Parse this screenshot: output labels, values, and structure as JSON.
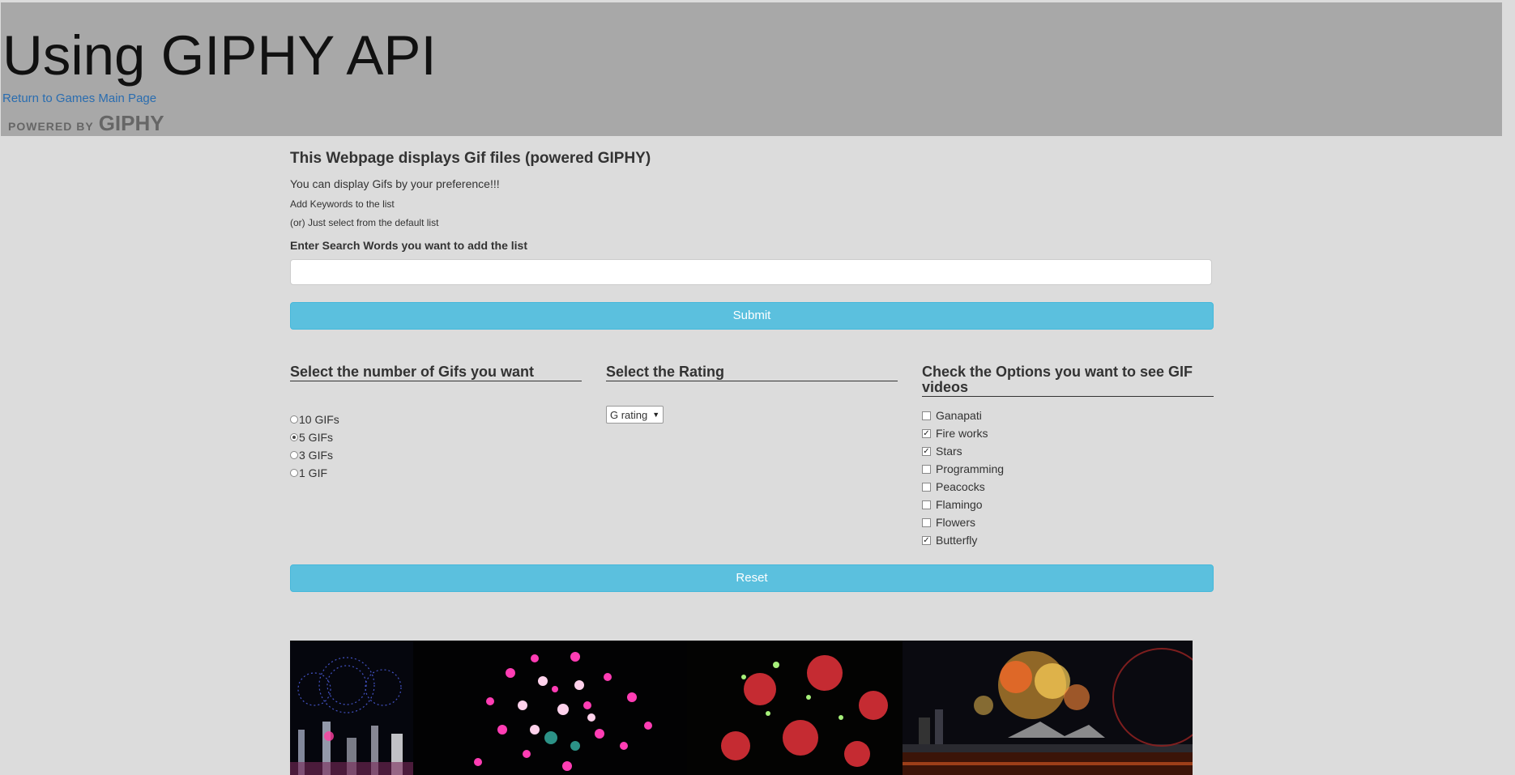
{
  "header": {
    "title": "Using GIPHY API",
    "return_link": "Return to Games Main Page",
    "powered_small": "POWERED BY",
    "powered_brand": "GIPHY"
  },
  "intro": {
    "heading": "This Webpage displays Gif files (powered GIPHY)",
    "line1": "You can display Gifs by your preference!!!",
    "line2": "Add Keywords to the list",
    "line3": "(or) Just select from the default list"
  },
  "search": {
    "label": "Enter Search Words you want to add the list",
    "value": "",
    "placeholder": "",
    "submit_label": "Submit"
  },
  "count": {
    "heading": "Select the number of Gifs you want",
    "options": [
      "10 GIFs",
      "5 GIFs",
      "3 GIFs",
      "1 GIF"
    ],
    "selected": "5 GIFs"
  },
  "rating": {
    "heading": "Select the Rating",
    "selected": "G rating",
    "arrow": "▼"
  },
  "options": {
    "heading": "Check the Options you want to see GIF videos",
    "items": [
      {
        "label": "Ganapati",
        "checked": false
      },
      {
        "label": "Fire works",
        "checked": true
      },
      {
        "label": "Stars",
        "checked": true
      },
      {
        "label": "Programming",
        "checked": false
      },
      {
        "label": "Peacocks",
        "checked": false
      },
      {
        "label": "Flamingo",
        "checked": false
      },
      {
        "label": "Flowers",
        "checked": false
      },
      {
        "label": "Butterfly",
        "checked": true
      }
    ]
  },
  "reset_label": "Reset",
  "gallery": {
    "images": [
      "fireworks-city-gif",
      "pink-bokeh-fireworks-gif",
      "red-fireworks-gif",
      "harbour-fireworks-gif"
    ]
  }
}
